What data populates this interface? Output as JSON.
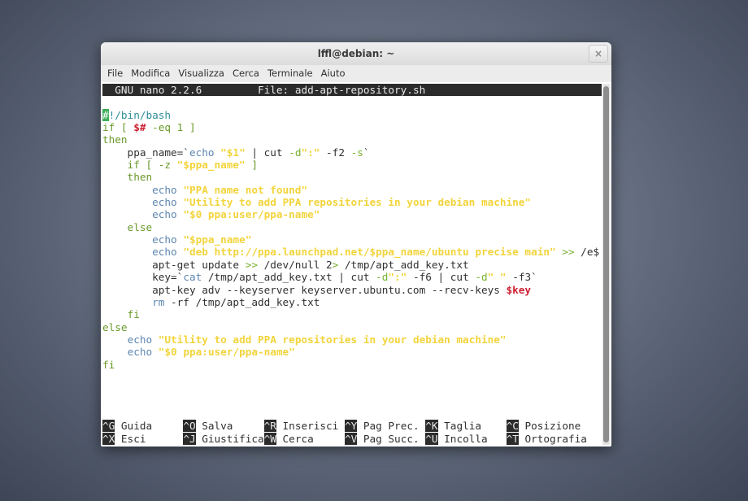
{
  "window": {
    "title": "lffl@debian: ~",
    "close_label": "×"
  },
  "menu": [
    "File",
    "Modifica",
    "Visualizza",
    "Cerca",
    "Terminale",
    "Aiuto"
  ],
  "nano_header": {
    "version": "GNU nano 2.2.6",
    "file": "File: add-apt-repository.sh"
  },
  "code_lines": [
    [
      [
        "#",
        "cur"
      ],
      [
        "!/bin/bash",
        "cm"
      ]
    ],
    [
      [
        "if [ ",
        "kw"
      ],
      [
        "$#",
        "rd"
      ],
      [
        " -eq 1 ]",
        "kw"
      ]
    ],
    [
      [
        "then",
        "kw"
      ]
    ],
    [
      [
        "    ppa_name=`",
        ""
      ],
      [
        "echo",
        "ec"
      ],
      [
        " ",
        ""
      ],
      [
        "\"$1\"",
        "st"
      ],
      [
        " | cut ",
        ""
      ],
      [
        "-d",
        "op"
      ],
      [
        "\":\"",
        "st"
      ],
      [
        " -f2 ",
        ""
      ],
      [
        "-s",
        "op"
      ],
      [
        "`",
        ""
      ]
    ],
    [
      [
        "    if [ -z ",
        "kw"
      ],
      [
        "\"$ppa_name\"",
        "st"
      ],
      [
        " ]",
        "kw"
      ]
    ],
    [
      [
        "    then",
        "kw"
      ]
    ],
    [
      [
        "        ",
        ""
      ],
      [
        "echo",
        "ec"
      ],
      [
        " ",
        ""
      ],
      [
        "\"PPA name not found\"",
        "st"
      ]
    ],
    [
      [
        "        ",
        ""
      ],
      [
        "echo",
        "ec"
      ],
      [
        " ",
        ""
      ],
      [
        "\"Utility to add PPA repositories in your debian machine\"",
        "st"
      ]
    ],
    [
      [
        "        ",
        ""
      ],
      [
        "echo",
        "ec"
      ],
      [
        " ",
        ""
      ],
      [
        "\"$0 ppa:user/ppa-name\"",
        "st"
      ]
    ],
    [
      [
        "    else",
        "kw"
      ]
    ],
    [
      [
        "        ",
        ""
      ],
      [
        "echo",
        "ec"
      ],
      [
        " ",
        ""
      ],
      [
        "\"$ppa_name\"",
        "st"
      ]
    ],
    [
      [
        "        ",
        ""
      ],
      [
        "echo",
        "ec"
      ],
      [
        " ",
        ""
      ],
      [
        "\"deb http://ppa.launchpad.net/$ppa_name/ubuntu precise main\"",
        "st"
      ],
      [
        " ",
        ""
      ],
      [
        ">>",
        "op"
      ],
      [
        " /e$",
        ""
      ]
    ],
    [
      [
        "        apt-get update ",
        ""
      ],
      [
        ">>",
        "op"
      ],
      [
        " /dev/null 2",
        ""
      ],
      [
        ">",
        "op"
      ],
      [
        " /tmp/apt_add_key.txt",
        ""
      ]
    ],
    [
      [
        "        key=`",
        ""
      ],
      [
        "cat",
        "ec"
      ],
      [
        " /tmp/apt_add_key.txt | cut ",
        ""
      ],
      [
        "-d",
        "op"
      ],
      [
        "\":\"",
        "st"
      ],
      [
        " -f6 | cut ",
        ""
      ],
      [
        "-d",
        "op"
      ],
      [
        "\" \"",
        "st"
      ],
      [
        " -f3`",
        ""
      ]
    ],
    [
      [
        "        apt-key adv --keyserver keyserver.ubuntu.com --recv-keys ",
        ""
      ],
      [
        "$key",
        "rd"
      ]
    ],
    [
      [
        "        ",
        ""
      ],
      [
        "rm",
        "ec"
      ],
      [
        " -rf /tmp/apt_add_key.txt",
        ""
      ]
    ],
    [
      [
        "    fi",
        "kw"
      ]
    ],
    [
      [
        "else",
        "kw"
      ]
    ],
    [
      [
        "    ",
        ""
      ],
      [
        "echo",
        "ec"
      ],
      [
        " ",
        ""
      ],
      [
        "\"Utility to add PPA repositories in your debian machine\"",
        "st"
      ]
    ],
    [
      [
        "    ",
        ""
      ],
      [
        "echo",
        "ec"
      ],
      [
        " ",
        ""
      ],
      [
        "\"$0 ppa:user/ppa-name\"",
        "st"
      ]
    ],
    [
      [
        "fi",
        "kw"
      ]
    ]
  ],
  "shortcuts": [
    [
      {
        "key": "^G",
        "label": "Guida"
      },
      {
        "key": "^O",
        "label": "Salva"
      },
      {
        "key": "^R",
        "label": "Inserisci"
      },
      {
        "key": "^Y",
        "label": "Pag Prec."
      },
      {
        "key": "^K",
        "label": "Taglia"
      },
      {
        "key": "^C",
        "label": "Posizione"
      }
    ],
    [
      {
        "key": "^X",
        "label": "Esci"
      },
      {
        "key": "^J",
        "label": "Giustifica"
      },
      {
        "key": "^W",
        "label": "Cerca"
      },
      {
        "key": "^V",
        "label": "Pag Succ."
      },
      {
        "key": "^U",
        "label": "Incolla"
      },
      {
        "key": "^T",
        "label": "Ortografia"
      }
    ]
  ]
}
